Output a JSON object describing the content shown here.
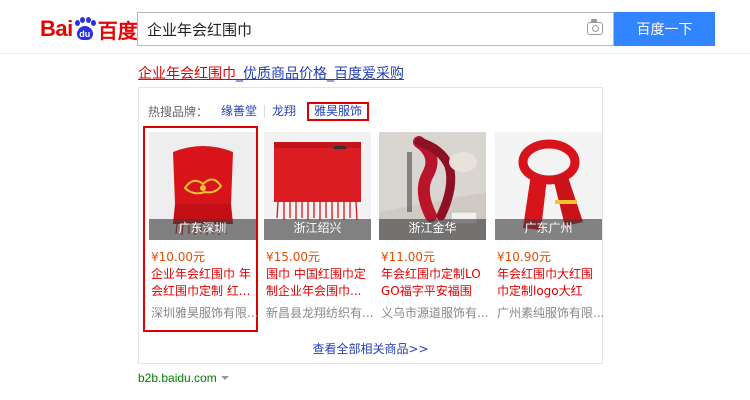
{
  "header": {
    "logo_bai": "Bai",
    "logo_du": "du",
    "logo_cn": "百度",
    "search_value": "企业年会红围巾",
    "search_button": "百度一下",
    "camera_icon": "camera-icon"
  },
  "result": {
    "title_highlight": "企业年会红围巾",
    "title_rest": "_优质商品价格_百度爱采购"
  },
  "brands": {
    "label": "热搜品牌：",
    "items": [
      "缘善堂",
      "龙翔",
      "雅昊服饰"
    ],
    "selected": "雅昊服饰"
  },
  "products": [
    {
      "location": "广东深圳",
      "price": "¥10.00元",
      "name": "企业年会红围巾 年会红围巾定制 红...",
      "shop": "深圳雅昊服饰有限...",
      "highlighted": true
    },
    {
      "location": "浙江绍兴",
      "price": "¥15.00元",
      "name": "围巾 中国红围巾定制企业年会围巾...",
      "shop": "新昌县龙翔纺织有...",
      "highlighted": false
    },
    {
      "location": "浙江金华",
      "price": "¥11.00元",
      "name": "年会红围巾定制LOGO福字平安福围",
      "shop": "义乌市源道服饰有...",
      "highlighted": false
    },
    {
      "location": "广东广州",
      "price": "¥10.90元",
      "name": "年会红围巾大红围巾定制logo大红色...",
      "shop": "广州素纯服饰有限...",
      "highlighted": false
    }
  ],
  "more_link": "查看全部相关商品>>",
  "footer_url": "b2b.baidu.com",
  "colors": {
    "brand_red": "#e10601",
    "brand_blue": "#2932e1",
    "search_button": "#3385ff",
    "link_blue": "#2440b3",
    "price_orange": "#e44d00",
    "highlight_red": "#e10000",
    "url_green": "#008000"
  }
}
